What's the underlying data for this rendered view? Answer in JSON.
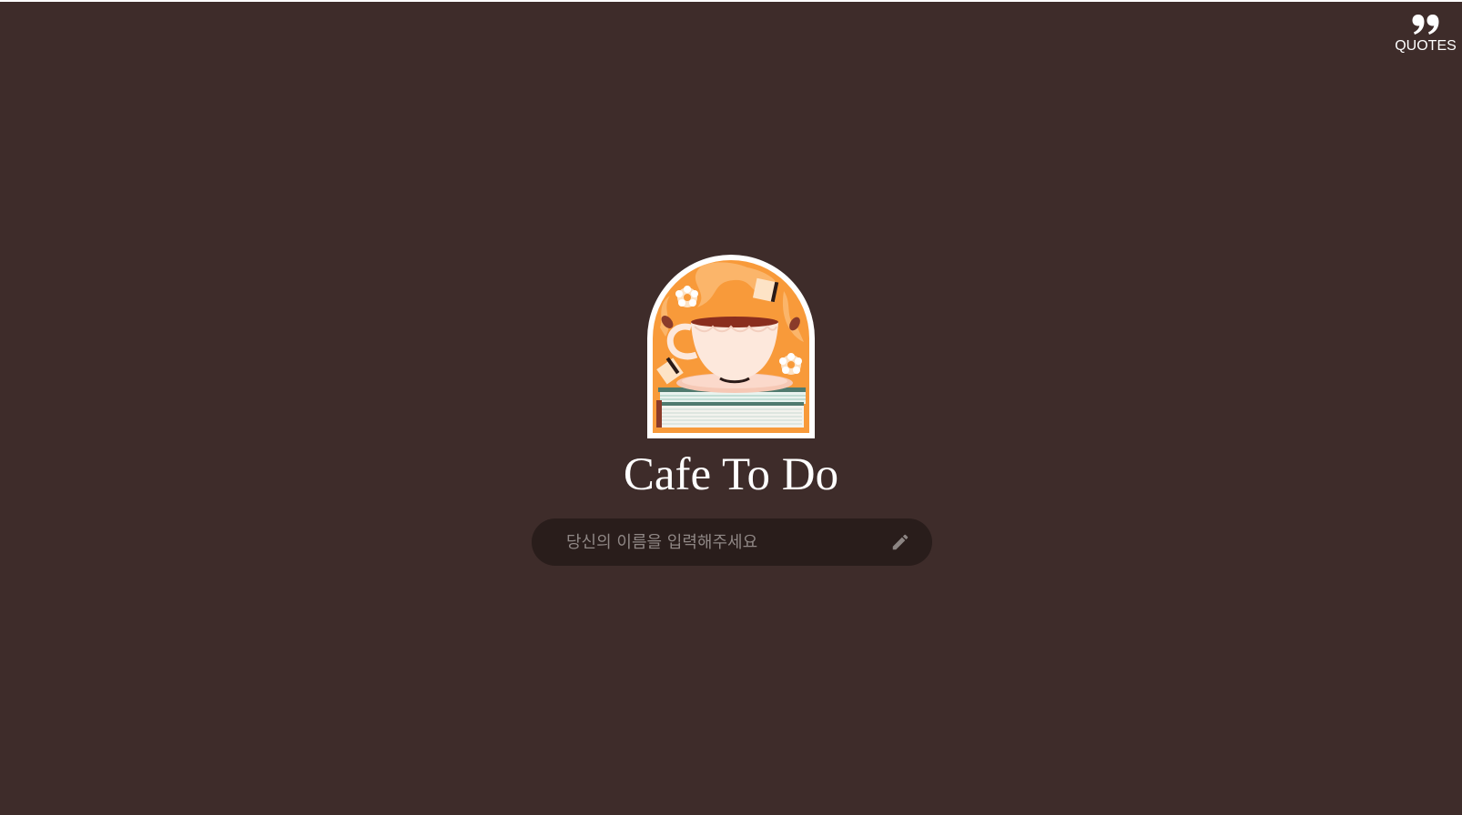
{
  "header": {
    "quotes_label": "QUOTES",
    "quotes_icon": "quote-icon"
  },
  "logo": {
    "description_icon": "coffee-cup-on-books-icon"
  },
  "main": {
    "title": "Cafe To Do",
    "name_input": {
      "placeholder": "당신의 이름을 입력해주세요",
      "value": ""
    },
    "edit_icon": "pencil-icon"
  },
  "colors": {
    "background": "#3e2c2a",
    "input_background": "#291d1b",
    "logo_orange": "#f89a3a",
    "text": "#ffffff",
    "placeholder": "#8f8785"
  }
}
